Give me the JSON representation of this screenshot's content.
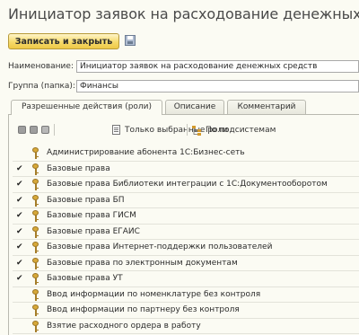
{
  "window": {
    "title": "Инициатор заявок на расходование денежных средств"
  },
  "toolbar": {
    "save_close_label": "Записать и закрыть"
  },
  "form": {
    "name_label": "Наименование:",
    "name_value": "Инициатор заявок на расходование денежных средств",
    "group_label": "Группа (папка):",
    "group_value": "Финансы"
  },
  "tabs": [
    {
      "label": "Разрешенные действия (роли)",
      "active": true
    },
    {
      "label": "Описание",
      "active": false
    },
    {
      "label": "Комментарий",
      "active": false
    }
  ],
  "roles_toolbar": {
    "only_selected_label": "Только выбранные роли",
    "by_subsystems_label": "По подсистемам"
  },
  "roles": [
    {
      "label": "Администрирование абонента 1С:Бизнес-сеть",
      "checked": false
    },
    {
      "label": "Базовые права",
      "checked": true
    },
    {
      "label": "Базовые права Библиотеки интеграции с 1С:Документооборотом",
      "checked": true
    },
    {
      "label": "Базовые права БП",
      "checked": true
    },
    {
      "label": "Базовые права ГИСМ",
      "checked": true
    },
    {
      "label": "Базовые права ЕГАИС",
      "checked": true
    },
    {
      "label": "Базовые права Интернет-поддержки пользователей",
      "checked": true
    },
    {
      "label": "Базовые права по электронным документам",
      "checked": true
    },
    {
      "label": "Базовые права УТ",
      "checked": true
    },
    {
      "label": "Ввод информации по номенклатуре без контроля",
      "checked": false
    },
    {
      "label": "Ввод информации по партнеру без контроля",
      "checked": false
    },
    {
      "label": "Взятие расходного ордера в работу",
      "checked": false
    }
  ]
}
